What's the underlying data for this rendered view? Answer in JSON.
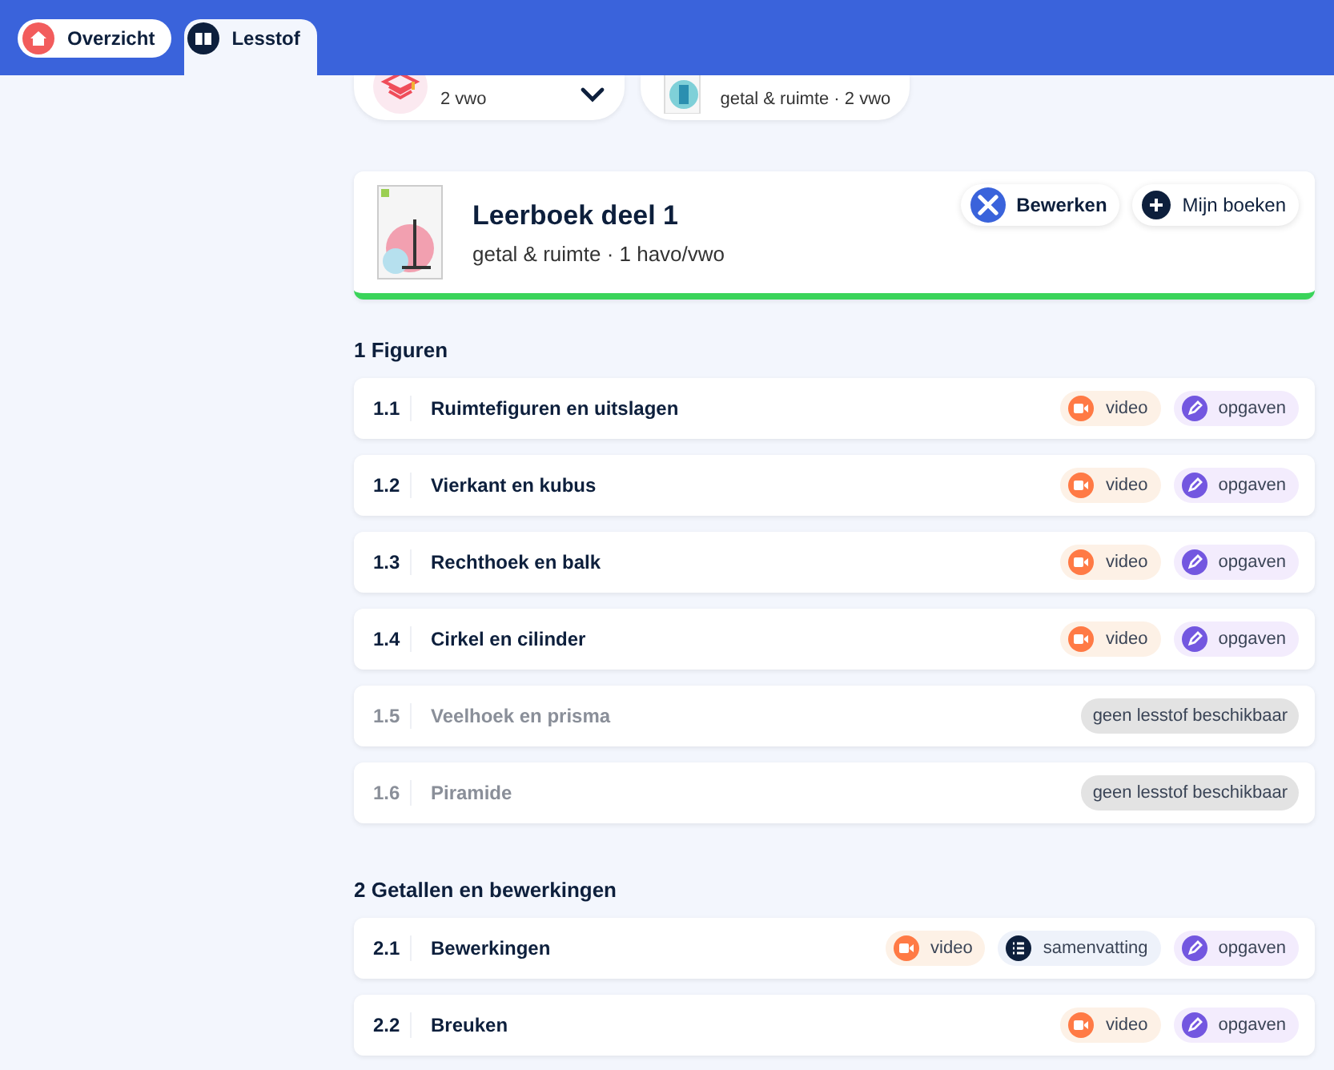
{
  "tabs": [
    {
      "label": "Overzicht",
      "selected": false
    },
    {
      "label": "Lesstof",
      "selected": true
    }
  ],
  "selectors": [
    {
      "kind": "method",
      "subtitle": "2 vwo"
    },
    {
      "kind": "book",
      "subtitle": "getal & ruimte · 2 vwo"
    }
  ],
  "book": {
    "title": "Leerboek deel 1",
    "subtitle": "getal & ruimte · 1 havo/vwo",
    "buttons": [
      {
        "kind": "edit",
        "label": "Bewerken"
      },
      {
        "kind": "add",
        "label": "Mijn boeken"
      }
    ]
  },
  "sections": [
    {
      "title": "1 Figuren",
      "lessons": [
        {
          "number": "1.1",
          "title": "Ruimtefiguren en uitslagen",
          "disabled": false,
          "chips": [
            {
              "kind": "video",
              "label": "video"
            },
            {
              "kind": "opgaven",
              "label": "opgaven"
            }
          ]
        },
        {
          "number": "1.2",
          "title": "Vierkant en kubus",
          "disabled": false,
          "chips": [
            {
              "kind": "video",
              "label": "video"
            },
            {
              "kind": "opgaven",
              "label": "opgaven"
            }
          ]
        },
        {
          "number": "1.3",
          "title": "Rechthoek en balk",
          "disabled": false,
          "chips": [
            {
              "kind": "video",
              "label": "video"
            },
            {
              "kind": "opgaven",
              "label": "opgaven"
            }
          ]
        },
        {
          "number": "1.4",
          "title": "Cirkel en cilinder",
          "disabled": false,
          "chips": [
            {
              "kind": "video",
              "label": "video"
            },
            {
              "kind": "opgaven",
              "label": "opgaven"
            }
          ]
        },
        {
          "number": "1.5",
          "title": "Veelhoek en prisma",
          "disabled": true,
          "chips": [
            {
              "kind": "none",
              "label": "geen lesstof beschikbaar"
            }
          ]
        },
        {
          "number": "1.6",
          "title": "Piramide",
          "disabled": true,
          "chips": [
            {
              "kind": "none",
              "label": "geen lesstof beschikbaar"
            }
          ]
        }
      ]
    },
    {
      "title": "2 Getallen en bewerkingen",
      "lessons": [
        {
          "number": "2.1",
          "title": "Bewerkingen",
          "disabled": false,
          "chips": [
            {
              "kind": "video",
              "label": "video"
            },
            {
              "kind": "samenvatting",
              "label": "samenvatting"
            },
            {
              "kind": "opgaven",
              "label": "opgaven"
            }
          ]
        },
        {
          "number": "2.2",
          "title": "Breuken",
          "disabled": false,
          "chips": [
            {
              "kind": "video",
              "label": "video"
            },
            {
              "kind": "opgaven",
              "label": "opgaven"
            }
          ]
        }
      ]
    }
  ]
}
